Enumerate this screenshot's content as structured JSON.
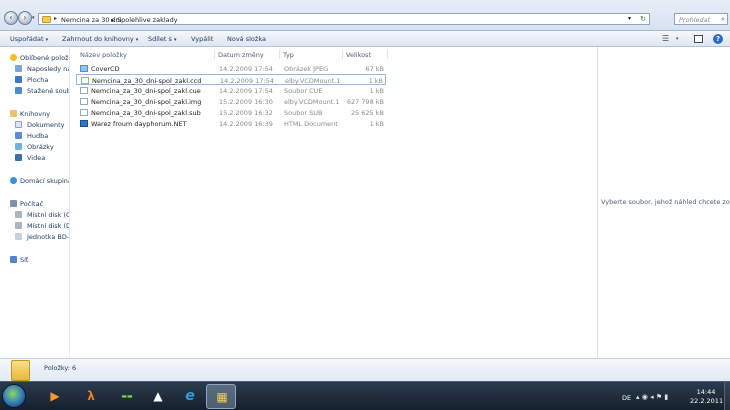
{
  "address": {
    "crumbs": [
      "Nemcina za 30 dni",
      "Spolehlive zaklady"
    ],
    "separator": "▸"
  },
  "search": {
    "placeholder": "Prohledat"
  },
  "toolbar": {
    "organize": "Uspořádat",
    "include_in_library": "Zahrnout do knihovny",
    "share_with": "Sdílet s",
    "burn": "Vypálit",
    "new_folder": "Nová složka"
  },
  "nav": {
    "favorites": {
      "label": "Oblíbené položky",
      "items": [
        "Naposledy nav",
        "Plocha",
        "Stažené soubor"
      ]
    },
    "libraries": {
      "label": "Knihovny",
      "items": [
        "Dokumenty",
        "Hudba",
        "Obrázky",
        "Videa"
      ]
    },
    "homegroup": "Domácí skupina",
    "computer": {
      "label": "Počítač",
      "items": [
        "Místní disk (C:)",
        "Místní disk (D:)",
        "Jednotka BD-R"
      ]
    },
    "network": "Síť"
  },
  "columns": {
    "name": "Název položky",
    "date": "Datum změny",
    "type": "Typ",
    "size": "Velikost"
  },
  "files": [
    {
      "name": "CoverCD",
      "date": "14.2.2009 17:54",
      "type": "Obrázek JPEG",
      "size": "67 kB",
      "icon": "image-file-icon"
    },
    {
      "name": "Nemcina_za_30_dni-spol_zakl.ccd",
      "date": "14.2.2009 17:54",
      "type": "elby.VCDMount.1",
      "size": "1 kB",
      "icon": "file-icon"
    },
    {
      "name": "Nemcina_za_30_dni-spol_zakl.cue",
      "date": "14.2.2009 17:54",
      "type": "Soubor CUE",
      "size": "1 kB",
      "icon": "file-icon"
    },
    {
      "name": "Nemcina_za_30_dni-spol_zakl.img",
      "date": "15.2.2009 16:30",
      "type": "elby.VCDMount.1",
      "size": "627 798 kB",
      "icon": "file-icon"
    },
    {
      "name": "Nemcina_za_30_dni-spol_zakl.sub",
      "date": "15.2.2009 16:32",
      "type": "Soubor SUB",
      "size": "25 625 kB",
      "icon": "file-icon"
    },
    {
      "name": "Warez froum dayphorum.NET",
      "date": "14.2.2009 16:39",
      "type": "HTML Document",
      "size": "1 kB",
      "icon": "html-file-icon"
    }
  ],
  "preview": {
    "message": "Vyberte soubor, jehož náhled chcete zobrazit."
  },
  "details": {
    "count": "Položky: 6"
  },
  "taskbar": {
    "language": "DE",
    "time": "14:44",
    "date": "22.2.2011",
    "apps": [
      "media-player-icon",
      "half-life-icon",
      "game-launcher-icon",
      "alcohol-icon",
      "internet-explorer-icon",
      "windows-explorer-icon"
    ]
  },
  "colors": {
    "accent": "#1e395b",
    "selection_border": "#9ab7de",
    "taskbar": "#1b2836"
  }
}
